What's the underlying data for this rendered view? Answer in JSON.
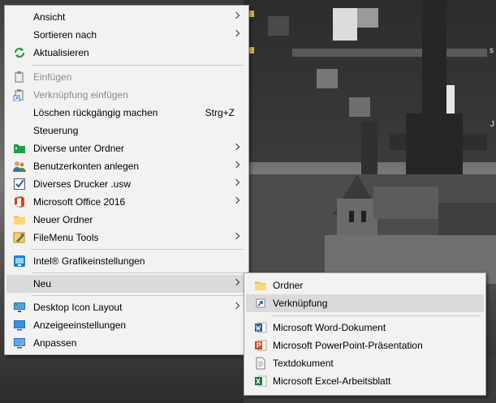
{
  "desktop": {
    "edge_text_top": "s",
    "edge_text_mid": "J"
  },
  "context_menu": {
    "items": [
      {
        "label": "Ansicht",
        "icon": "none",
        "has_submenu": true
      },
      {
        "label": "Sortieren nach",
        "icon": "none",
        "has_submenu": true
      },
      {
        "label": "Aktualisieren",
        "icon": "refresh-icon",
        "has_submenu": false
      },
      {
        "label": "Einfügen",
        "icon": "paste-icon",
        "disabled": true
      },
      {
        "label": "Verknüpfung einfügen",
        "icon": "paste-shortcut-icon",
        "disabled": true
      },
      {
        "label": "Löschen rückgängig machen",
        "icon": "none",
        "shortcut": "Strg+Z"
      },
      {
        "label": "Steuerung",
        "icon": "none"
      },
      {
        "label": "Diverse unter Ordner",
        "icon": "green-folder-icon",
        "has_submenu": true
      },
      {
        "label": "Benutzerkonten anlegen",
        "icon": "users-icon",
        "has_submenu": true
      },
      {
        "label": "Diverses Drucker .usw",
        "icon": "checkbox-icon",
        "has_submenu": true
      },
      {
        "label": "Microsoft Office 2016",
        "icon": "office-icon",
        "has_submenu": true
      },
      {
        "label": "Neuer Ordner",
        "icon": "folder-icon"
      },
      {
        "label": "FileMenu Tools",
        "icon": "filemenu-tools-icon",
        "has_submenu": true
      },
      {
        "label": "Intel® Grafikeinstellungen",
        "icon": "intel-graphics-icon"
      },
      {
        "label": "Neu",
        "icon": "none",
        "has_submenu": true,
        "highlighted": true
      },
      {
        "label": "Desktop Icon Layout",
        "icon": "monitor-icon",
        "has_submenu": true
      },
      {
        "label": "Anzeigeeinstellungen",
        "icon": "display-settings-icon"
      },
      {
        "label": "Anpassen",
        "icon": "personalize-icon"
      }
    ]
  },
  "submenu_neu": {
    "items": [
      {
        "label": "Ordner",
        "icon": "folder-icon"
      },
      {
        "label": "Verknüpfung",
        "icon": "shortcut-icon",
        "highlighted": true
      },
      {
        "label": "Microsoft Word-Dokument",
        "icon": "word-icon"
      },
      {
        "label": "Microsoft PowerPoint-Präsentation",
        "icon": "powerpoint-icon"
      },
      {
        "label": "Textdokument",
        "icon": "text-document-icon"
      },
      {
        "label": "Microsoft Excel-Arbeitsblatt",
        "icon": "excel-icon"
      }
    ]
  },
  "colors": {
    "menu_bg": "#f2f2f2",
    "highlight_bg": "#dadada",
    "disabled_text": "#8a8a8a"
  }
}
